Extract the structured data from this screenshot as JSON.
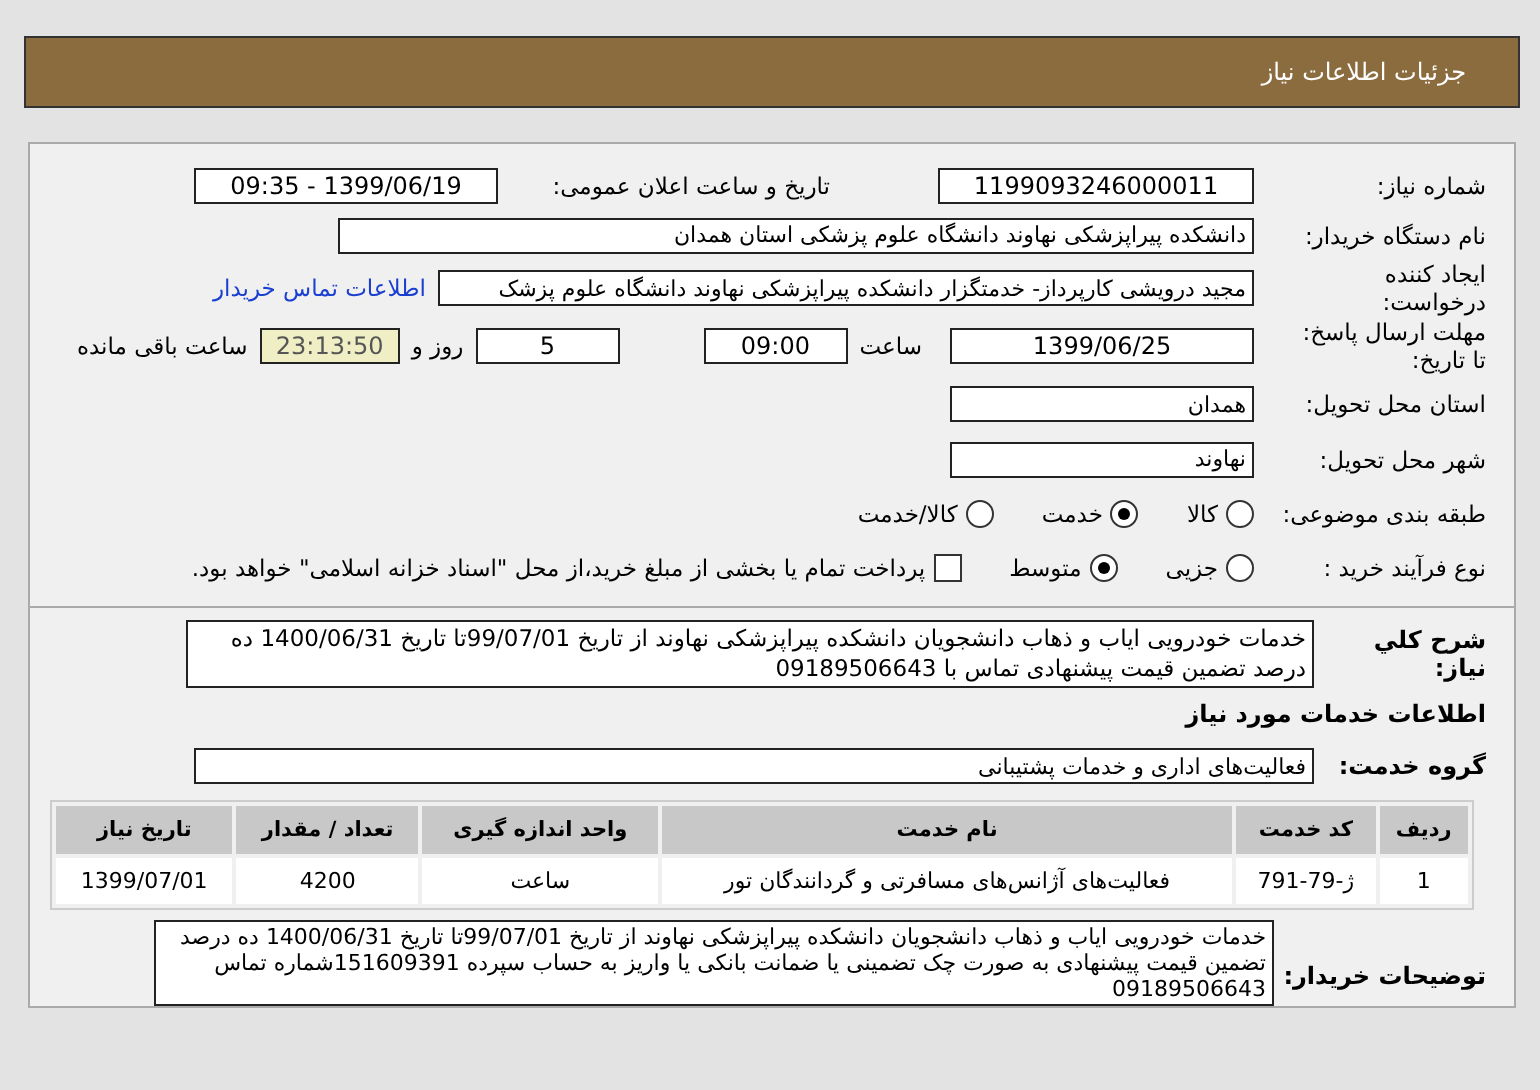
{
  "header": {
    "title": "جزئیات اطلاعات نیاز"
  },
  "need_number": {
    "label": "شماره نیاز:",
    "value": "1199093246000011"
  },
  "announce": {
    "label": "تاریخ و ساعت اعلان عمومی:",
    "value": "1399/06/19 - 09:35"
  },
  "buyer": {
    "label": "نام دستگاه خریدار:",
    "value": "دانشکده پیراپزشکی نهاوند دانشگاه علوم پزشکی استان همدان"
  },
  "requester": {
    "label_lines": [
      "ایجاد کننده",
      "درخواست:"
    ],
    "value": "مجید درویشی کارپرداز- خدمتگزار دانشکده پیراپزشکی نهاوند دانشگاه علوم پزشک",
    "link": "اطلاعات تماس خریدار"
  },
  "deadline": {
    "label_lines": [
      "مهلت ارسال پاسخ:",
      "تا تاریخ:"
    ],
    "date": "1399/06/25",
    "time_label": "ساعت",
    "time": "09:00",
    "days": "5",
    "days_label": "روز و",
    "remaining": "23:13:50",
    "remaining_label": "ساعت باقی مانده"
  },
  "province": {
    "label": "استان محل تحویل:",
    "value": "همدان"
  },
  "city": {
    "label": "شهر محل تحویل:",
    "value": "نهاوند"
  },
  "category": {
    "label": "طبقه بندی موضوعی:",
    "options": [
      {
        "label": "کالا",
        "selected": false
      },
      {
        "label": "خدمت",
        "selected": true
      },
      {
        "label": "کالا/خدمت",
        "selected": false
      }
    ]
  },
  "process": {
    "label": "نوع فرآیند خرید :",
    "options": [
      {
        "label": "جزیی",
        "selected": false
      },
      {
        "label": "متوسط",
        "selected": true
      }
    ],
    "payment": {
      "label": "پرداخت تمام یا بخشی از مبلغ خرید،از محل \"اسناد خزانه اسلامی\" خواهد بود.",
      "checked": false
    }
  },
  "description": {
    "label": "شرح کلي نياز:",
    "value": "خدمات خودرویی ایاب و ذهاب دانشجویان دانشکده پیراپزشکی نهاوند از تاریخ 99/07/01تا تاریخ 1400/06/31 ده درصد تضمین قیمت پیشنهادی تماس با 09189506643"
  },
  "services_heading": "اطلاعات خدمات مورد نیاز",
  "service_group": {
    "label": "گروه خدمت:",
    "value": "فعالیت‌های اداری و خدمات پشتیبانی"
  },
  "table": {
    "columns": [
      "ردیف",
      "کد خدمت",
      "نام خدمت",
      "واحد اندازه گیری",
      "تعداد / مقدار",
      "تاریخ نیاز"
    ],
    "rows": [
      [
        "1",
        "ژ-79-791",
        "فعالیت‌های آژانس‌های مسافرتی و گردانندگان تور",
        "ساعت",
        "4200",
        "1399/07/01"
      ]
    ]
  },
  "buyer_notes": {
    "label": "توضیحات خریدار:",
    "value": "خدمات خودرویی ایاب و ذهاب دانشجویان دانشکده پیراپزشکی نهاوند از تاریخ 99/07/01تا تاریخ 1400/06/31 ده درصد تضمین قیمت پیشنهادی به صورت چک تضمینی یا ضمانت بانکی یا واریز به حساب سپرده 151609391شماره تماس 09189506643"
  }
}
